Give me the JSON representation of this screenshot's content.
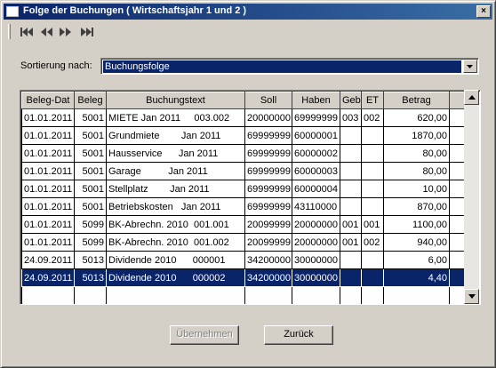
{
  "window": {
    "title": "Folge der Buchungen ( Wirtschaftsjahr 1 und 2 )",
    "close_glyph": "×"
  },
  "toolbar": {
    "icons": [
      "first-record-icon",
      "previous-record-icon",
      "next-record-icon",
      "last-record-icon"
    ]
  },
  "sort": {
    "label": "Sortierung nach:",
    "value": "Buchungsfolge"
  },
  "table": {
    "columns": [
      "Beleg-Dat",
      "Beleg",
      "Buchungstext",
      "Soll",
      "Haben",
      "Geb",
      "ET",
      "Betrag"
    ],
    "rows": [
      [
        "01.01.2011",
        "5001",
        "MIETE Jan 2011     003.002",
        "20000000",
        "69999999",
        "003",
        "002",
        "620,00"
      ],
      [
        "01.01.2011",
        "5001",
        "Grundmiete        Jan 2011",
        "69999999",
        "60000001",
        "",
        "",
        "1870,00"
      ],
      [
        "01.01.2011",
        "5001",
        "Hausservice      Jan 2011",
        "69999999",
        "60000002",
        "",
        "",
        "80,00"
      ],
      [
        "01.01.2011",
        "5001",
        "Garage          Jan 2011",
        "69999999",
        "60000003",
        "",
        "",
        "80,00"
      ],
      [
        "01.01.2011",
        "5001",
        "Stellplatz        Jan 2011",
        "69999999",
        "60000004",
        "",
        "",
        "10,00"
      ],
      [
        "01.01.2011",
        "5001",
        "Betriebskosten   Jan 2011",
        "69999999",
        "43110000",
        "",
        "",
        "870,00"
      ],
      [
        "01.01.2011",
        "5099",
        "BK-Abrechn. 2010  001.001",
        "20099999",
        "20000000",
        "001",
        "001",
        "1100,00"
      ],
      [
        "01.01.2011",
        "5099",
        "BK-Abrechn. 2010  001.002",
        "20099999",
        "20000000",
        "001",
        "002",
        "940,00"
      ],
      [
        "24.09.2011",
        "5013",
        "Dividende 2010      000001",
        "34200000",
        "30000000",
        "",
        "",
        "6,00"
      ],
      [
        "24.09.2011",
        "5013",
        "Dividende 2010      000002",
        "34200000",
        "30000000",
        "",
        "",
        "4,40"
      ]
    ],
    "selected_row": 9
  },
  "buttons": {
    "apply": "Übernehmen",
    "back": "Zurück"
  },
  "colors": {
    "selection": "#0a246a",
    "face": "#d4d0c8",
    "title_start": "#0a246a",
    "title_end": "#3a6ea5"
  }
}
